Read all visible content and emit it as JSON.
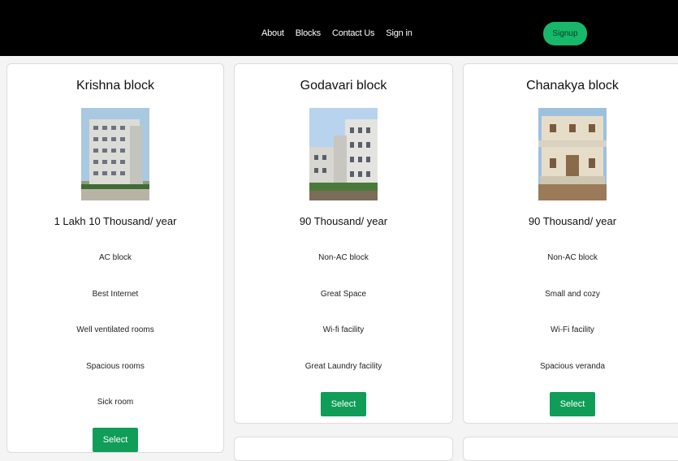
{
  "nav": {
    "links": [
      "About",
      "Blocks",
      "Contact Us",
      "Sign in"
    ],
    "signup_label": "Signup",
    "accent": "#17b86a"
  },
  "blocks": [
    {
      "title": "Krishna block",
      "price": "1 Lakh 10 Thousand/ year",
      "features": [
        "AC block",
        "Best Internet",
        "Well ventilated rooms",
        "Spacious rooms",
        "Sick room"
      ],
      "select_label": "Select"
    },
    {
      "title": "Godavari block",
      "price": "90 Thousand/ year",
      "features": [
        "Non-AC block",
        "Great Space",
        "Wi-fi facility",
        "Great Laundry facility"
      ],
      "select_label": "Select"
    },
    {
      "title": "Chanakya block",
      "price": "90 Thousand/ year",
      "features": [
        "Non-AC block",
        "Small and cozy",
        "Wi-Fi facility",
        "Spacious veranda"
      ],
      "select_label": "Select"
    }
  ],
  "colors": {
    "select_button": "#0f9d58",
    "navbar": "#000000"
  }
}
